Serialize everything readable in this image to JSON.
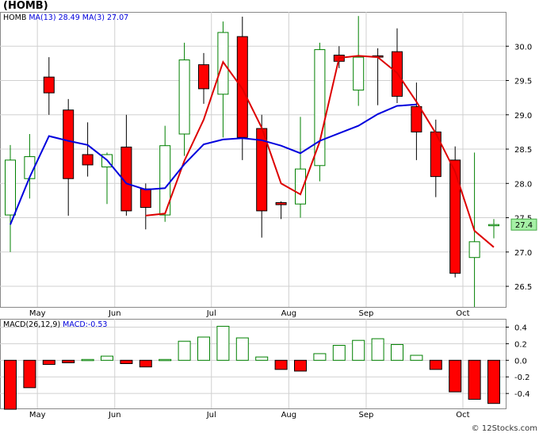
{
  "title": "(HOMB)",
  "watermark": "© 12Stocks.com",
  "colors": {
    "up": "#008000",
    "down": "#ff0000",
    "ma_short": "#0000dd",
    "ma_long": "#dd0000",
    "grid": "#d0d0d0",
    "tag_bg": "#a6f0a6"
  },
  "chart_data": [
    {
      "type": "candlestick",
      "legend": {
        "ticker": "HOMB",
        "ma13_label": "MA(13)",
        "ma13_value": "28.49",
        "ma3_label": "MA(3)",
        "ma3_value": "27.07"
      },
      "last_price_tag": "27.4",
      "ylim": [
        26.2,
        30.5
      ],
      "y_ticks": [
        26.5,
        27.0,
        27.5,
        28.0,
        28.5,
        29.0,
        29.5,
        30.0
      ],
      "y_tick_labels": [
        "26.5",
        "27.0",
        "27.5",
        "28.0",
        "28.5",
        "29.0",
        "29.5",
        "30.0"
      ],
      "month_labels": [
        "May",
        "Jun",
        "Jul",
        "Aug",
        "Sep",
        "Oct"
      ],
      "month_positions": [
        1.4,
        5.4,
        10.4,
        14.4,
        18.4,
        23.4
      ],
      "candles": [
        {
          "o": 27.54,
          "h": 28.56,
          "l": 27.0,
          "c": 28.34
        },
        {
          "o": 28.07,
          "h": 28.72,
          "l": 27.78,
          "c": 28.39
        },
        {
          "o": 29.55,
          "h": 29.84,
          "l": 29.0,
          "c": 29.32
        },
        {
          "o": 29.07,
          "h": 29.23,
          "l": 27.53,
          "c": 28.07
        },
        {
          "o": 28.42,
          "h": 28.89,
          "l": 28.1,
          "c": 28.27
        },
        {
          "o": 28.24,
          "h": 28.45,
          "l": 27.7,
          "c": 28.42
        },
        {
          "o": 28.53,
          "h": 29.0,
          "l": 27.53,
          "c": 27.6
        },
        {
          "o": 27.92,
          "h": 28.0,
          "l": 27.33,
          "c": 27.65
        },
        {
          "o": 27.54,
          "h": 28.84,
          "l": 27.44,
          "c": 28.55
        },
        {
          "o": 28.72,
          "h": 30.05,
          "l": 28.4,
          "c": 29.8
        },
        {
          "o": 29.73,
          "h": 29.9,
          "l": 29.16,
          "c": 29.38
        },
        {
          "o": 29.3,
          "h": 30.36,
          "l": 28.67,
          "c": 30.2
        },
        {
          "o": 30.14,
          "h": 30.43,
          "l": 28.34,
          "c": 28.67
        },
        {
          "o": 28.8,
          "h": 29.0,
          "l": 27.21,
          "c": 27.6
        },
        {
          "o": 27.72,
          "h": 27.74,
          "l": 27.48,
          "c": 27.69
        },
        {
          "o": 27.7,
          "h": 28.97,
          "l": 27.5,
          "c": 28.21
        },
        {
          "o": 28.26,
          "h": 30.05,
          "l": 28.03,
          "c": 29.95
        },
        {
          "o": 29.87,
          "h": 30.0,
          "l": 29.68,
          "c": 29.78
        },
        {
          "o": 29.36,
          "h": 30.44,
          "l": 29.13,
          "c": 29.84
        },
        {
          "o": 29.86,
          "h": 29.97,
          "l": 29.14,
          "c": 29.84
        },
        {
          "o": 29.92,
          "h": 30.26,
          "l": 29.17,
          "c": 29.27
        },
        {
          "o": 29.12,
          "h": 29.47,
          "l": 28.34,
          "c": 28.75
        },
        {
          "o": 28.75,
          "h": 28.93,
          "l": 27.8,
          "c": 28.1
        },
        {
          "o": 28.34,
          "h": 28.54,
          "l": 26.63,
          "c": 26.69
        },
        {
          "o": 26.92,
          "h": 28.45,
          "l": 26.2,
          "c": 27.15
        },
        {
          "o": 27.4,
          "h": 27.48,
          "l": 27.2,
          "c": 27.4
        }
      ],
      "ma13": [
        27.4,
        28.09,
        28.69,
        28.62,
        28.56,
        28.34,
        28.0,
        27.91,
        27.93,
        28.28,
        28.57,
        28.64,
        28.66,
        28.63,
        28.55,
        28.44,
        28.62,
        28.73,
        28.84,
        29.01,
        29.13,
        29.15,
        null,
        null,
        null,
        null
      ],
      "ma3": [
        null,
        null,
        null,
        null,
        null,
        null,
        null,
        27.53,
        27.56,
        28.33,
        28.93,
        29.77,
        29.38,
        28.81,
        28.0,
        27.84,
        28.61,
        29.83,
        29.86,
        29.84,
        29.61,
        29.19,
        28.73,
        28.17,
        27.31,
        27.07
      ]
    },
    {
      "type": "bar",
      "legend": {
        "label": "MACD(26,12,9)",
        "value_label": "MACD:-0.53"
      },
      "ylim": [
        -0.58,
        0.5
      ],
      "y_ticks": [
        0.4,
        0.2,
        0.0,
        -0.2,
        -0.4
      ],
      "y_tick_labels": [
        "0.4",
        "0.2",
        "0.0",
        "-0.2",
        "-0.4"
      ],
      "month_labels": [
        "May",
        "Jun",
        "Jul",
        "Aug",
        "Sep",
        "Oct"
      ],
      "month_positions": [
        1.4,
        5.4,
        10.4,
        14.4,
        18.4,
        23.4
      ],
      "values": [
        -0.59,
        -0.33,
        -0.05,
        -0.03,
        0.01,
        0.05,
        -0.04,
        -0.08,
        0.01,
        0.23,
        0.28,
        0.41,
        0.27,
        0.04,
        -0.11,
        -0.13,
        0.08,
        0.18,
        0.24,
        0.26,
        0.19,
        0.06,
        -0.11,
        -0.38,
        -0.47,
        -0.52
      ]
    }
  ]
}
